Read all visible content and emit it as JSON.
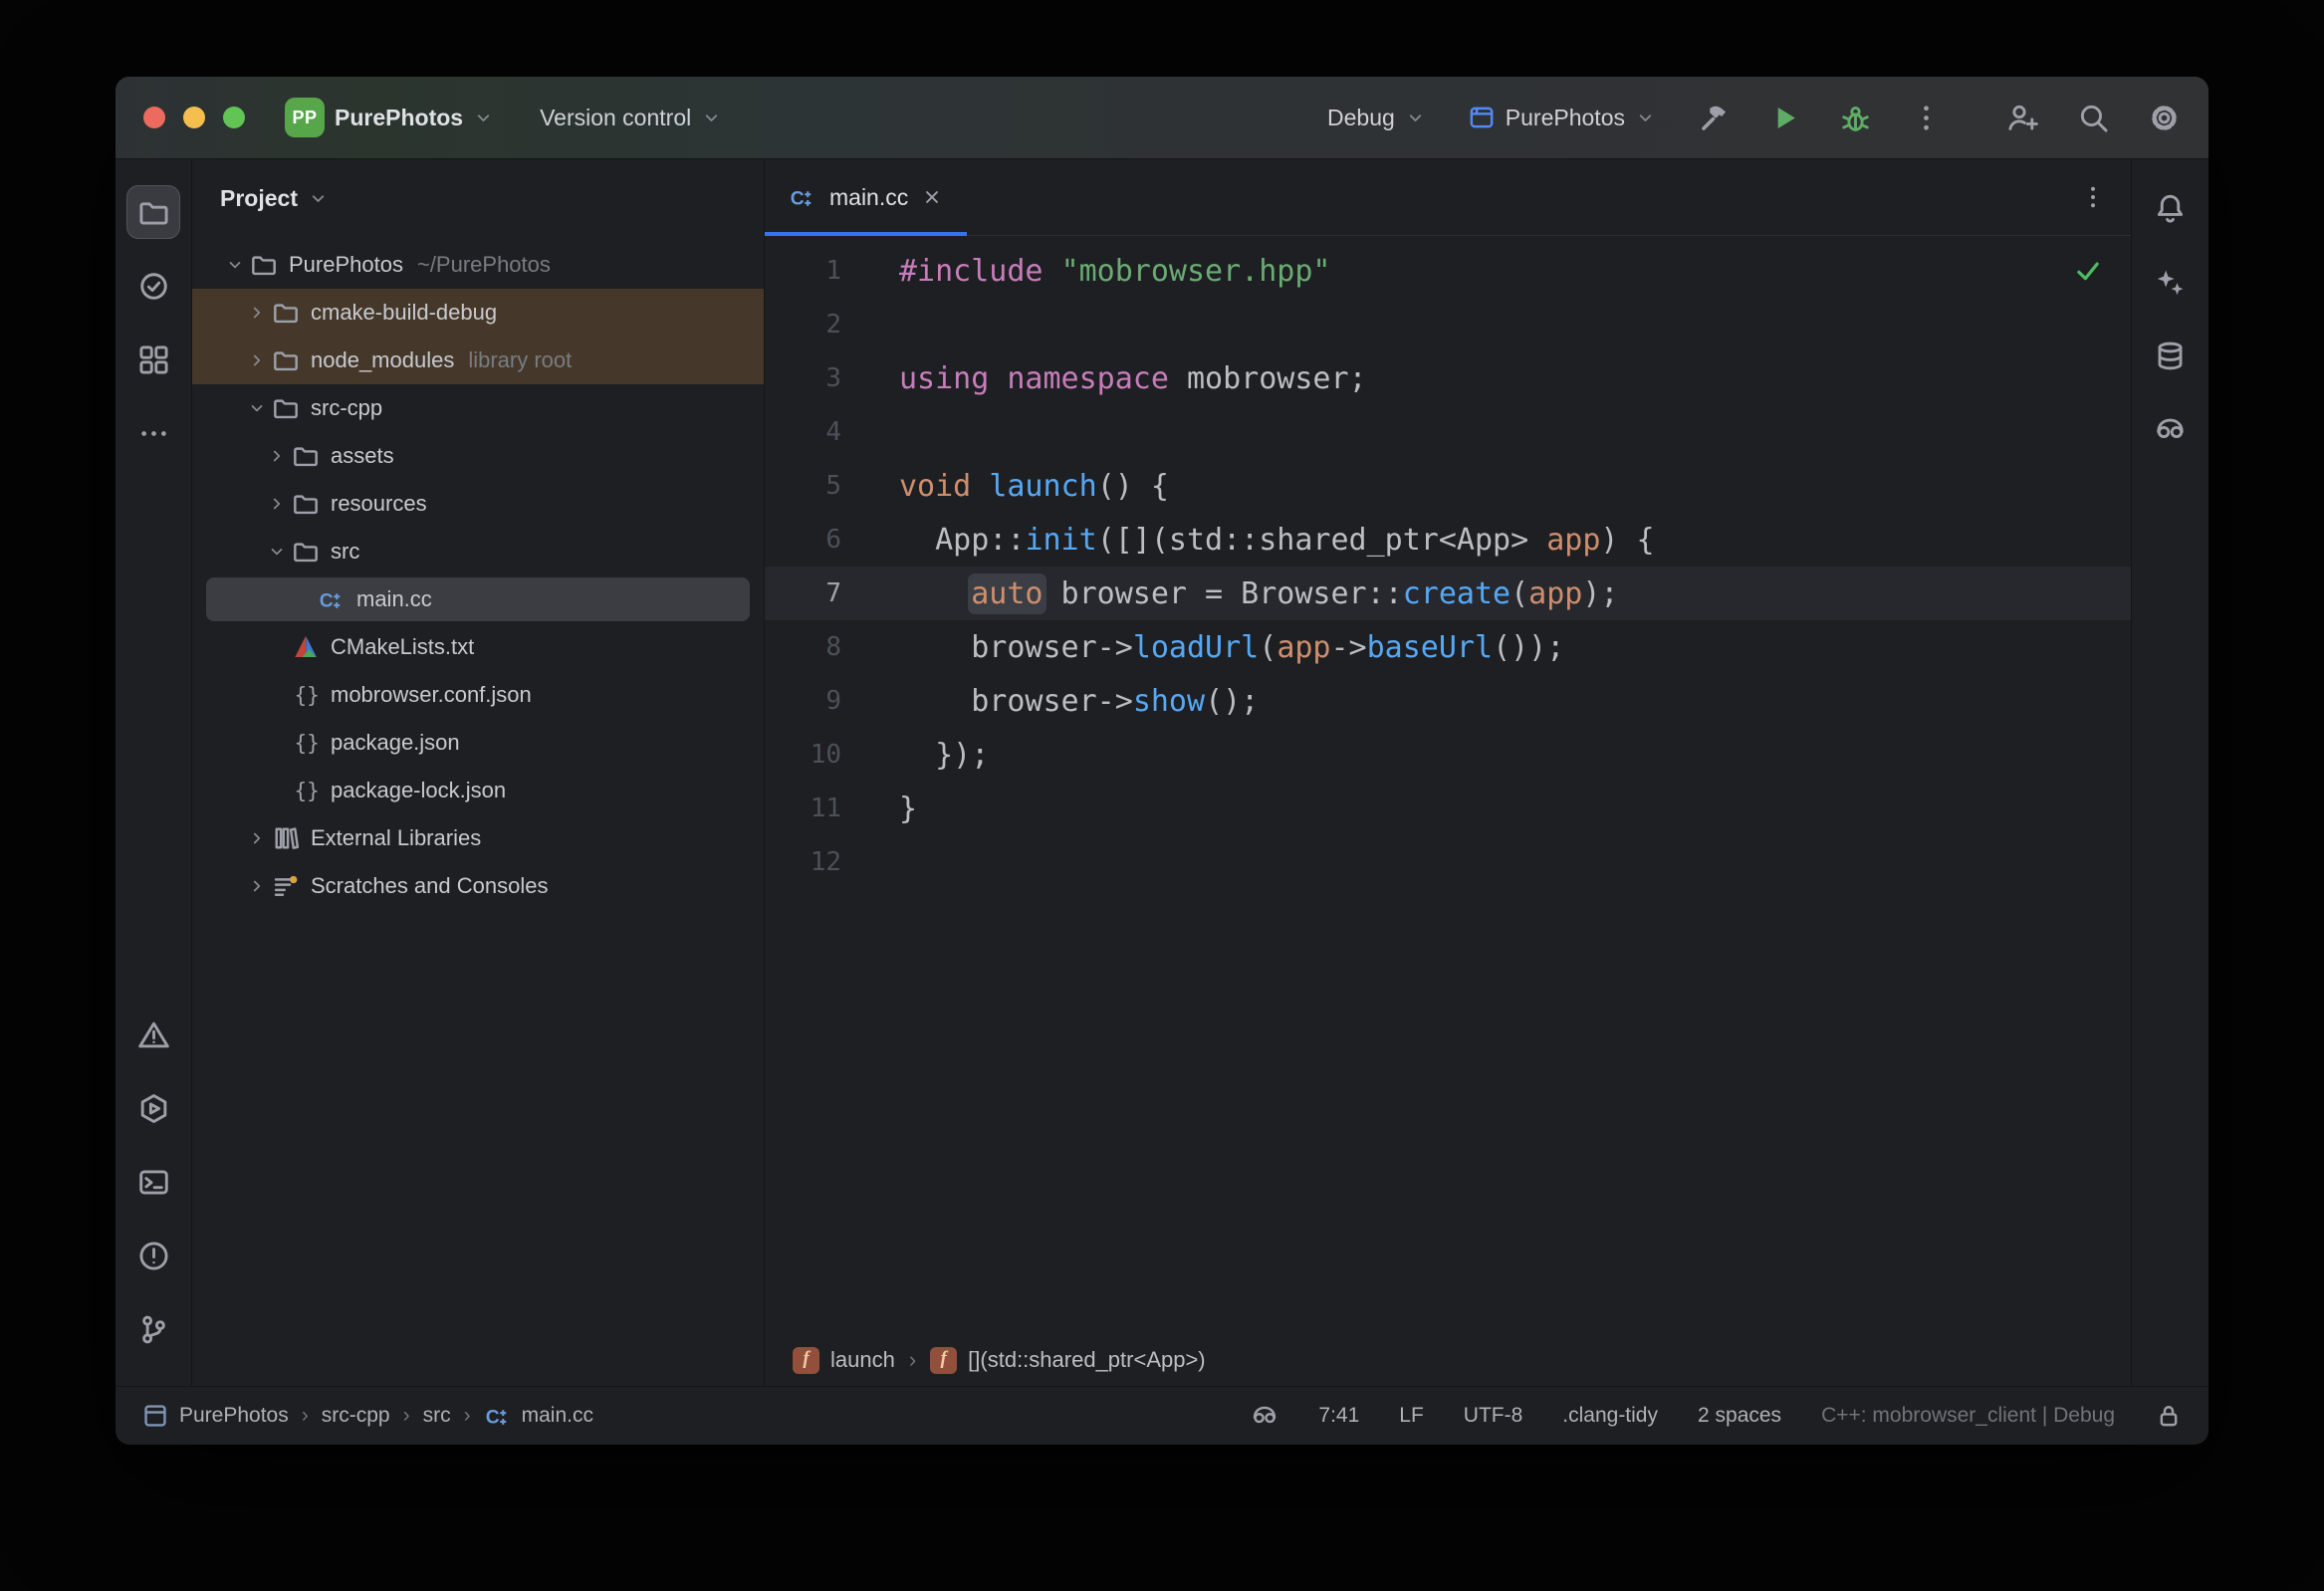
{
  "colors": {
    "accent": "#3574f0",
    "run_green": "#5fad65",
    "excluded_row_bg": "#45382a",
    "selection_bg": "#3b3d42",
    "keyword": "#cf8e6d",
    "preprocessor": "#c77dbb",
    "string": "#6aab73",
    "function_call": "#56a8f5",
    "project_badge_bg": "#57a64a"
  },
  "separator": "›",
  "titlebar": {
    "project_badge": "PP",
    "project_name": "PurePhotos",
    "version_control": "Version control",
    "run_mode": "Debug",
    "run_config": "PurePhotos",
    "actions": [
      {
        "id": "build"
      },
      {
        "id": "run",
        "green": true
      },
      {
        "id": "debug",
        "green": true
      },
      {
        "id": "kebab"
      },
      {
        "id": "add-user",
        "gap": true
      },
      {
        "id": "search"
      },
      {
        "id": "settings"
      }
    ]
  },
  "left_rail": {
    "top": [
      {
        "id": "project",
        "active": true
      },
      {
        "id": "commit"
      },
      {
        "id": "structure"
      },
      {
        "id": "more"
      }
    ],
    "bottom": [
      {
        "id": "problems-triangle"
      },
      {
        "id": "services"
      },
      {
        "id": "terminal"
      },
      {
        "id": "problems"
      },
      {
        "id": "version-control"
      }
    ]
  },
  "right_rail": [
    {
      "id": "notifications"
    },
    {
      "id": "ai-assistant"
    },
    {
      "id": "database"
    },
    {
      "id": "copilot"
    }
  ],
  "project_panel": {
    "header": "Project",
    "tree": [
      {
        "label": "PurePhotos",
        "suffix": "~/PurePhotos",
        "level": 0,
        "chevron": "open",
        "icon": "folder"
      },
      {
        "label": "cmake-build-debug",
        "level": 1,
        "chevron": "closed",
        "icon": "folder",
        "excluded": true
      },
      {
        "label": "node_modules",
        "suffix": "library root",
        "level": 1,
        "chevron": "closed",
        "icon": "folder",
        "excluded": true
      },
      {
        "label": "src-cpp",
        "level": 1,
        "chevron": "open",
        "icon": "folder"
      },
      {
        "label": "assets",
        "level": 2,
        "chevron": "closed",
        "icon": "folder"
      },
      {
        "label": "resources",
        "level": 2,
        "chevron": "closed",
        "icon": "folder"
      },
      {
        "label": "src",
        "level": 2,
        "chevron": "open",
        "icon": "folder"
      },
      {
        "label": "main.cc",
        "level": 3,
        "icon": "cpp",
        "selected": true
      },
      {
        "label": "CMakeLists.txt",
        "level": 2,
        "icon": "cmake"
      },
      {
        "label": "mobrowser.conf.json",
        "level": 2,
        "icon": "json"
      },
      {
        "label": "package.json",
        "level": 2,
        "icon": "json"
      },
      {
        "label": "package-lock.json",
        "level": 2,
        "icon": "json"
      },
      {
        "label": "External Libraries",
        "level": 1,
        "chevron": "closed",
        "icon": "library"
      },
      {
        "label": "Scratches and Consoles",
        "level": 1,
        "chevron": "closed",
        "icon": "scratches"
      }
    ]
  },
  "editor": {
    "tab": "main.cc",
    "function_badge": "f",
    "lines": [
      {
        "num": "1",
        "seg": [
          [
            "p",
            "#include"
          ],
          [
            "d",
            " "
          ],
          [
            "s",
            "\"mobrowser.hpp\""
          ]
        ]
      },
      {
        "num": "2",
        "seg": []
      },
      {
        "num": "3",
        "seg": [
          [
            "p",
            "using"
          ],
          [
            "d",
            " "
          ],
          [
            "p",
            "namespace"
          ],
          [
            "d",
            " mobrowser;"
          ]
        ]
      },
      {
        "num": "4",
        "seg": []
      },
      {
        "num": "5",
        "seg": [
          [
            "k",
            "void"
          ],
          [
            "d",
            " "
          ],
          [
            "f",
            "launch"
          ],
          [
            "d",
            "() {"
          ]
        ]
      },
      {
        "num": "6",
        "seg": [
          [
            "d",
            "  App::"
          ],
          [
            "f",
            "init"
          ],
          [
            "d",
            "([](std::shared_ptr<App> "
          ],
          [
            "k",
            "app"
          ],
          [
            "d",
            ") {"
          ]
        ]
      },
      {
        "num": "7",
        "current": true,
        "seg": [
          [
            "d",
            "    "
          ],
          [
            "kb",
            "auto"
          ],
          [
            "d",
            " browser = Browser::"
          ],
          [
            "f",
            "create"
          ],
          [
            "d",
            "("
          ],
          [
            "k",
            "app"
          ],
          [
            "d",
            ");"
          ]
        ]
      },
      {
        "num": "8",
        "seg": [
          [
            "d",
            "    browser->"
          ],
          [
            "f",
            "loadUrl"
          ],
          [
            "d",
            "("
          ],
          [
            "k",
            "app"
          ],
          [
            "d",
            "->"
          ],
          [
            "f",
            "baseUrl"
          ],
          [
            "d",
            "());"
          ]
        ]
      },
      {
        "num": "9",
        "seg": [
          [
            "d",
            "    browser->"
          ],
          [
            "f",
            "show"
          ],
          [
            "d",
            "();"
          ]
        ]
      },
      {
        "num": "10",
        "seg": [
          [
            "d",
            "  });"
          ]
        ]
      },
      {
        "num": "11",
        "seg": [
          [
            "d",
            "}"
          ]
        ]
      },
      {
        "num": "12",
        "seg": []
      }
    ],
    "breadcrumbs": [
      "launch",
      "[](std::shared_ptr<App>)"
    ]
  },
  "statusbar": {
    "path": [
      "PurePhotos",
      "src-cpp",
      "src",
      "main.cc"
    ],
    "items": [
      "7:41",
      "LF",
      "UTF-8",
      ".clang-tidy",
      "2 spaces"
    ],
    "context": "C++: mobrowser_client | Debug"
  }
}
